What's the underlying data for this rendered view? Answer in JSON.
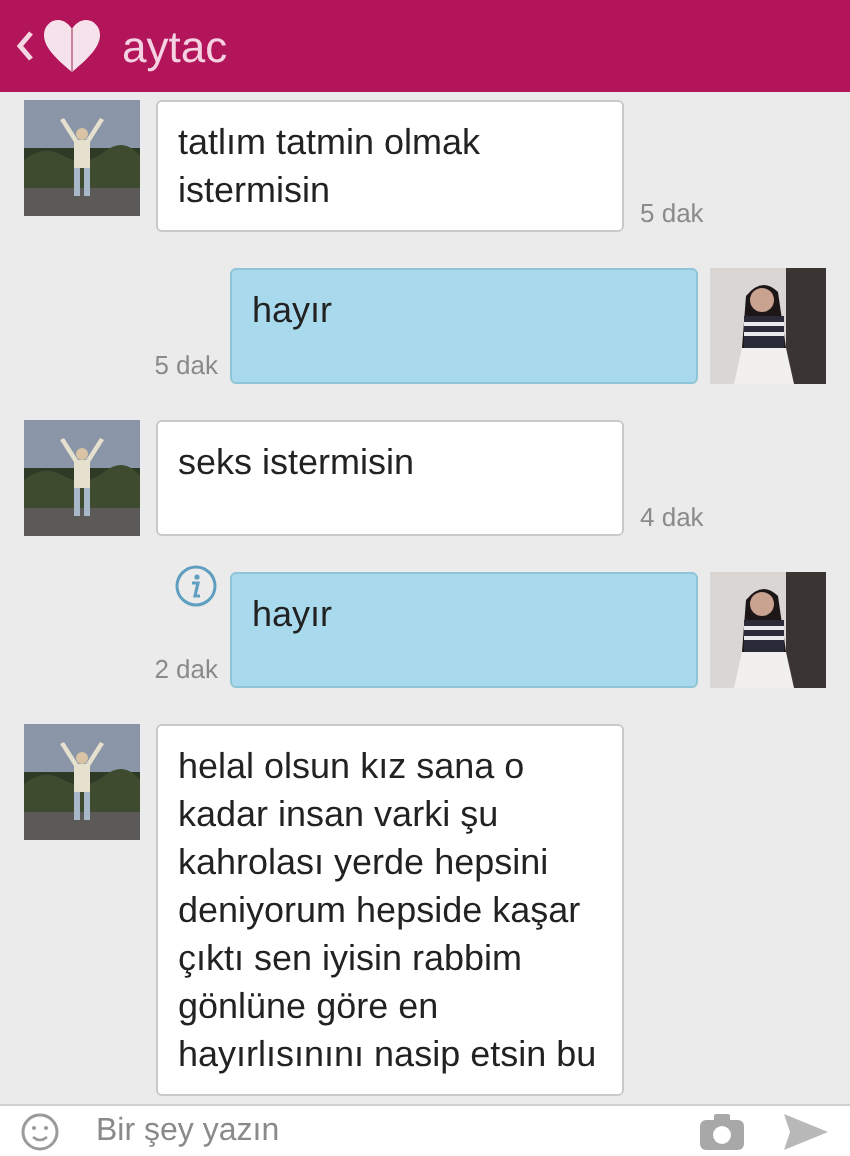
{
  "header": {
    "title": "aytac"
  },
  "messages": [
    {
      "kind": "incoming",
      "text": "tatlım tatmin olmak istermisin",
      "time": "5 dak"
    },
    {
      "kind": "outgoing",
      "text": "hayır",
      "time": "5 dak",
      "info": false
    },
    {
      "kind": "incoming",
      "text": "seks istermisin",
      "time": "4 dak"
    },
    {
      "kind": "outgoing",
      "text": "hayır",
      "time": "2 dak",
      "info": true
    },
    {
      "kind": "incoming",
      "text": "helal olsun kız sana o kadar insan varki şu kahrolası yerde hepsini deniyorum hepside kaşar çıktı sen iyisin rabbim gönlüne göre en hayırlısınını nasip etsin bu"
    }
  ],
  "composer": {
    "placeholder": "Bir şey yazın"
  }
}
